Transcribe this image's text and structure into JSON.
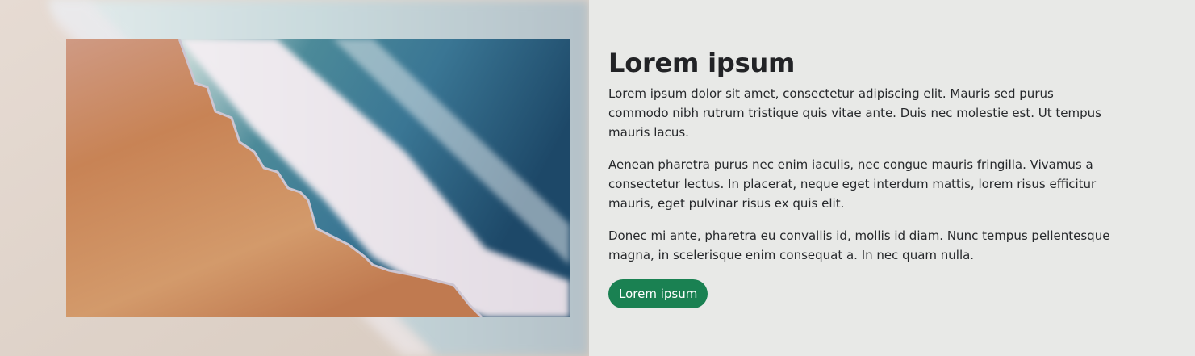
{
  "feature": {
    "image": {
      "description_icon": "beach-aerial-image"
    },
    "heading": "Lorem ipsum",
    "paragraphs": [
      "Lorem ipsum dolor sit amet, consectetur adipiscing elit. Mauris sed purus commodo nibh rutrum tristique quis vitae ante. Duis nec molestie est. Ut tempus mauris lacus.",
      "Aenean pharetra purus nec enim iaculis, nec congue mauris fringilla. Vivamus a consectetur lectus. In placerat, neque eget interdum mattis, lorem risus efficitur mauris, eget pulvinar risus ex quis elit.",
      "Donec mi ante, pharetra eu convallis id, mollis id diam. Nunc tempus pellentesque magna, in scelerisque enim consequat a. In nec quam nulla."
    ],
    "button_label": "Lorem ipsum"
  },
  "colors": {
    "accent": "#1a8152",
    "text": "#222326",
    "panel_bg": "#e8e9e7",
    "sand": "#c7855a",
    "sea": "#3a7a94",
    "foam": "#ece6ea"
  }
}
